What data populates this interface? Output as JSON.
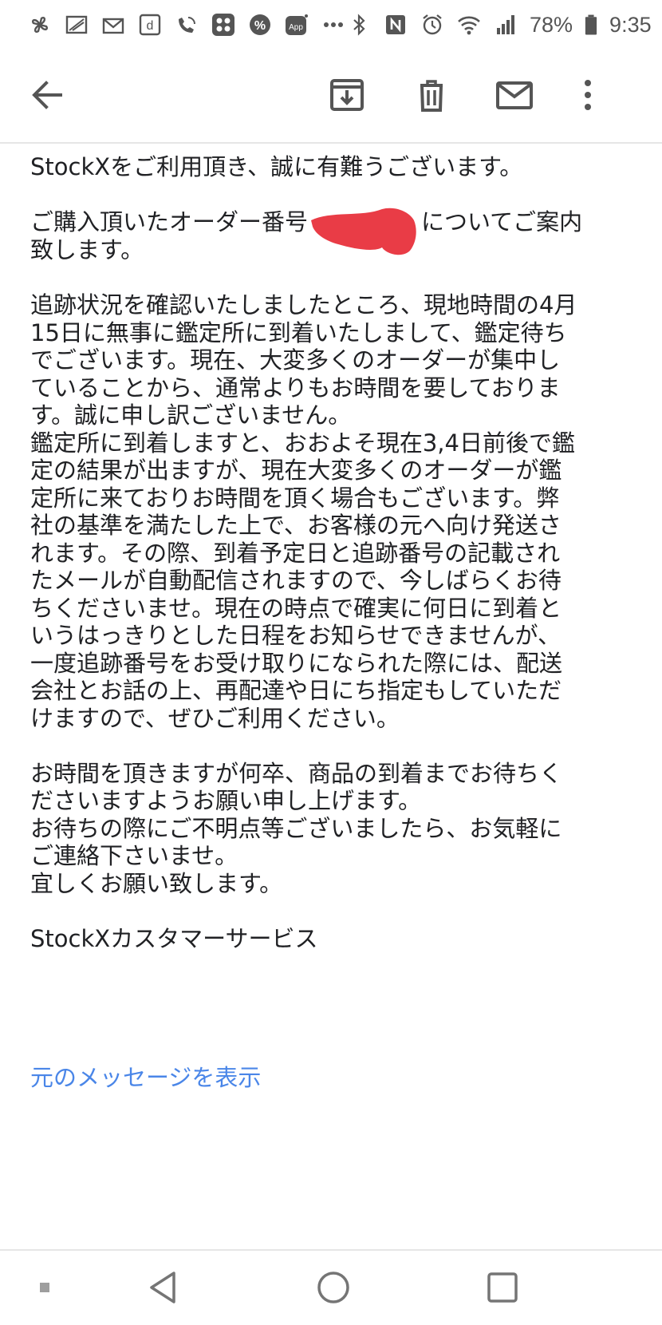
{
  "status_bar": {
    "battery_percent": "78%",
    "time": "9:35",
    "icons": [
      "pinwheel-icon",
      "slash-box-icon",
      "mail-icon",
      "d-app-icon",
      "wifi-calling-icon",
      "grid-app-icon",
      "percent-app-icon",
      "app-badge-icon",
      "more-dots-icon",
      "bluetooth-icon",
      "nfc-icon",
      "alarm-icon",
      "wifi-icon",
      "signal-icon",
      "battery-icon"
    ],
    "left_app_labels": {
      "d": "d",
      "percent": "%",
      "app": "App",
      "dots": "•••"
    }
  },
  "toolbar": {
    "icons": [
      "back-arrow-icon",
      "archive-icon",
      "delete-icon",
      "mark-unread-icon",
      "overflow-menu-icon"
    ]
  },
  "email": {
    "p1": "StockXをご利用頂き、誠に有難うございます。",
    "p2_before": "ご購入頂いたオーダー番号",
    "p2_after": "についてご案内",
    "p2_line2": "致します。",
    "p3_lines": [
      "追跡状況を確認いたしましたところ、現地時間の4月",
      "15日に無事に鑑定所に到着いたしまして、鑑定待ち",
      "でございます。現在、大変多くのオーダーが集中し",
      "ていることから、通常よりもお時間を要しておりま",
      "す。誠に申し訳ございません。",
      "鑑定所に到着しますと、おおよそ現在3,4日前後で鑑",
      "定の結果が出ますが、現在大変多くのオーダーが鑑",
      "定所に来ておりお時間を頂く場合もございます。弊",
      "社の基準を満たした上で、お客様の元へ向け発送さ",
      "れます。その際、到着予定日と追跡番号の記載され",
      "たメールが自動配信されますので、今しばらくお待",
      "ちくださいませ。現在の時点で確実に何日に到着と",
      "いうはっきりとした日程をお知らせできませんが、",
      "一度追跡番号をお受け取りになられた際には、配送",
      "会社とお話の上、再配達や日にち指定もしていただ",
      "けますので、ぜひご利用ください。"
    ],
    "p4_lines": [
      "お時間を頂きますが何卒、商品の到着までお待ちく",
      "ださいますようお願い申し上げます。",
      "お待ちの際にご不明点等ございましたら、お気軽に",
      "ご連絡下さいませ。",
      "宜しくお願い致します。"
    ],
    "signature": "StockXカスタマーサービス",
    "view_original_link": "元のメッセージを表示",
    "redaction_color": "#e8323c"
  },
  "nav_bar": {
    "icons": [
      "recents-small-icon",
      "back-triangle-icon",
      "home-circle-icon",
      "overview-square-icon"
    ]
  }
}
